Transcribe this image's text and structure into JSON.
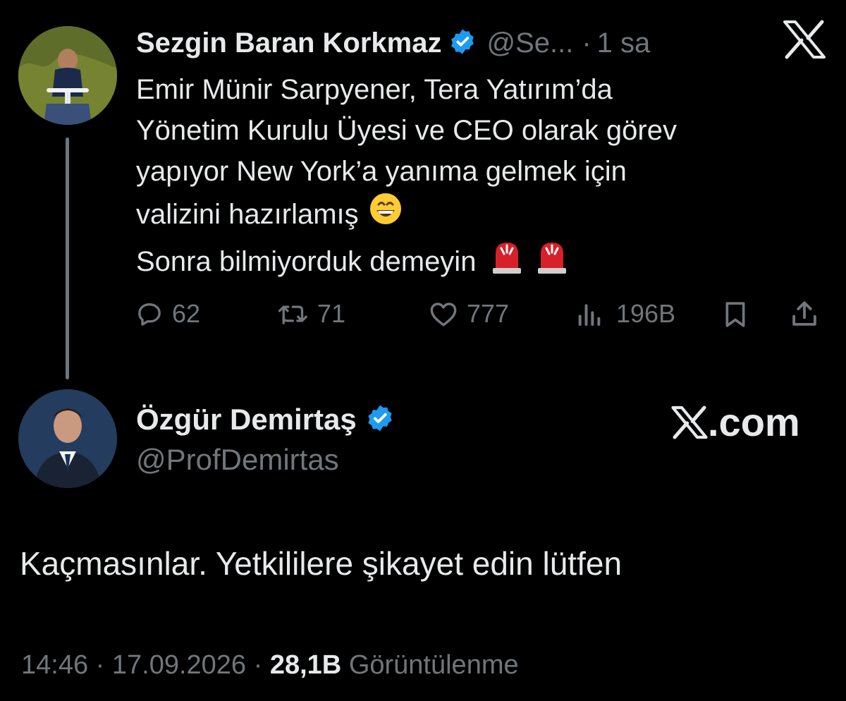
{
  "parent_tweet": {
    "author_name": "Sezgin Baran Korkmaz",
    "handle": "@Se...",
    "separator": "·",
    "time": "1 sa",
    "lines": [
      "Emir Münir Sarpyener, Tera Yatırım’da",
      "Yönetim Kurulu Üyesi ve CEO olarak görev",
      "yapıyor New York’a yanıma gelmek için",
      "valizini hazırlamış",
      "Sonra bilmiyorduk demeyin"
    ],
    "stats": {
      "replies": "62",
      "retweets": "71",
      "likes": "777",
      "views": "196B"
    },
    "icons": [
      "reply-icon",
      "retweet-icon",
      "like-icon",
      "views-icon",
      "bookmark-icon",
      "share-icon"
    ]
  },
  "reply_tweet": {
    "author_name": "Özgür Demirtaş",
    "handle": "@ProfDemirtas",
    "text": "Kaçmasınlar. Yetkililere şikayet edin lütfen",
    "time": "14:46",
    "date": "17.09.2026",
    "dot": "·",
    "views_count": "28,1B",
    "views_label": "Görüntülenme"
  },
  "brand": {
    "x_logo": "x-logo-icon",
    "xcom_suffix": ".com"
  },
  "colors": {
    "background": "#000000",
    "text": "#e7e9ea",
    "muted": "#71767b",
    "verified": "#1d9bf0"
  }
}
